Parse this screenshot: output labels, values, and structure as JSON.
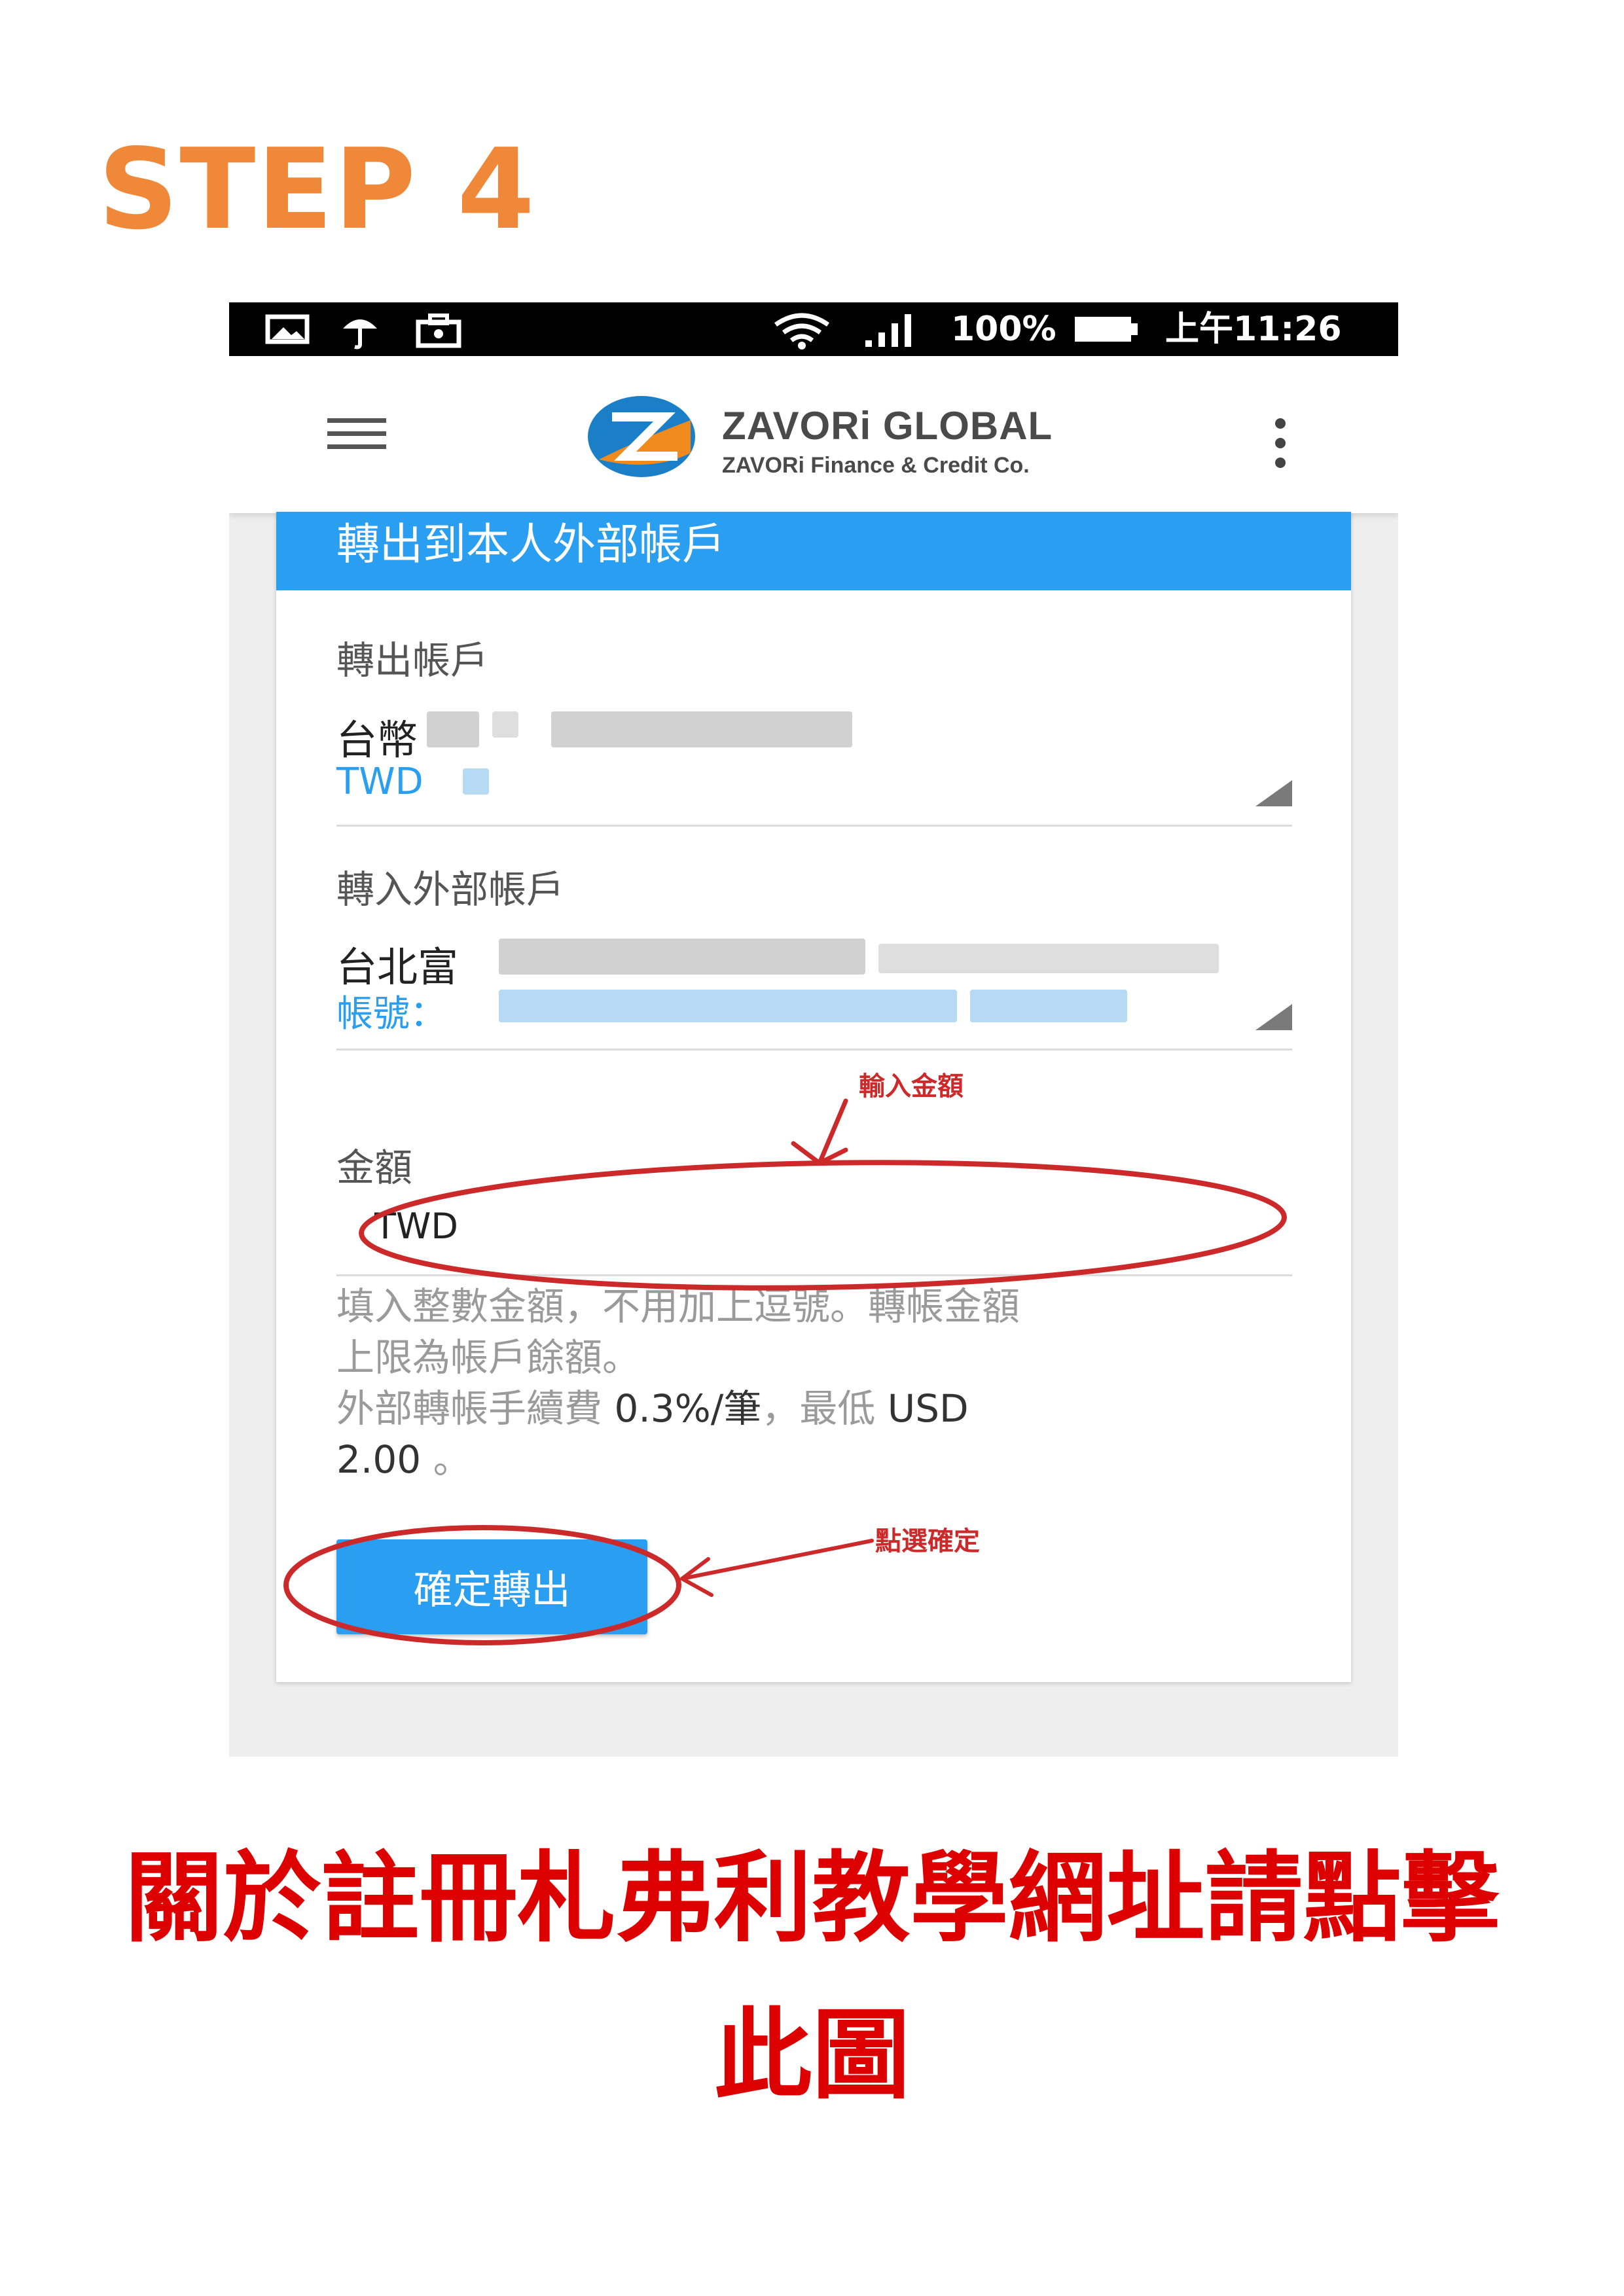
{
  "step_title": "STEP 4",
  "status_bar": {
    "battery": "100%",
    "time": "上午11:26",
    "icons": [
      "photo-icon",
      "umbrella-icon",
      "briefcase-icon",
      "wifi-icon",
      "signal-icon",
      "battery-icon"
    ]
  },
  "app_bar": {
    "brand_title": "ZAVORi GLOBAL",
    "brand_subtitle": "ZAVORi Finance & Credit Co."
  },
  "form": {
    "header": "轉出到本人外部帳戶",
    "from_account": {
      "label": "轉出帳戶",
      "name": "台幣",
      "currency": "TWD"
    },
    "to_account": {
      "label": "轉入外部帳戶",
      "name": "台北富",
      "account_prefix": "帳號："
    },
    "amount": {
      "label": "金額",
      "currency": "TWD",
      "value": ""
    },
    "hint_line1": "填入整數金額，不用加上逗號。轉帳金額",
    "hint_line2": "上限為帳戶餘額。",
    "hint_line3_prefix": "外部轉帳手續費 ",
    "hint_fee": "0.3%/筆",
    "hint_line3_mid": "，最低 ",
    "hint_min": "USD",
    "hint_line4": "2.00",
    "hint_line4_suffix": " 。",
    "confirm_button": "確定轉出"
  },
  "annotations": {
    "enter_amount": "輸入金額",
    "click_confirm": "點選確定",
    "color": "#cc2a2a"
  },
  "bottom_link": {
    "line1": "關於註冊札弗利教學網址請點擊",
    "line2": "此圖",
    "color": "#dd0000"
  },
  "colors": {
    "step_title": "#f0883a",
    "accent_blue": "#2a9ef0"
  }
}
